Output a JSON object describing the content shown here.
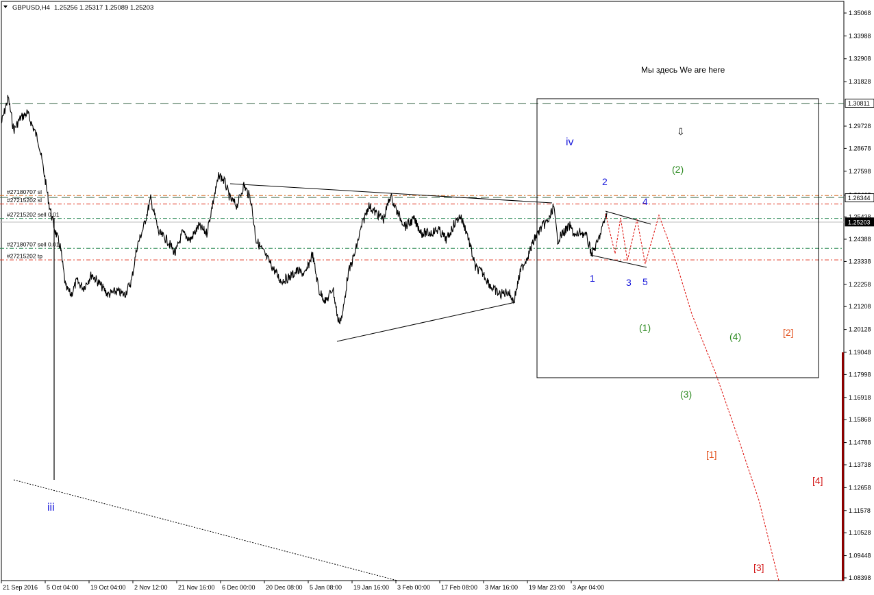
{
  "header": {
    "symbol_label": "GBPUSD,H4",
    "quote_values": "1.25256 1.25317 1.25089 1.25203",
    "dropdown_icon": "triangle-down-icon"
  },
  "price_axis": {
    "ticks": [
      "1.35068",
      "1.33988",
      "1.32908",
      "1.31828",
      "1.29728",
      "1.28678",
      "1.27598",
      "1.26468",
      "1.25438",
      "1.24388",
      "1.23338",
      "1.22258",
      "1.21208",
      "1.20128",
      "1.19048",
      "1.17998",
      "1.16918",
      "1.15868",
      "1.14788",
      "1.13738",
      "1.12658",
      "1.11578",
      "1.10528",
      "1.09448",
      "1.08398"
    ],
    "tick_values": [
      1.35068,
      1.33988,
      1.32908,
      1.31828,
      1.29728,
      1.28678,
      1.27598,
      1.26468,
      1.25438,
      1.24388,
      1.23338,
      1.22258,
      1.21208,
      1.20128,
      1.19048,
      1.17998,
      1.16918,
      1.15868,
      1.14788,
      1.13738,
      1.12658,
      1.11578,
      1.10528,
      1.09448,
      1.08398
    ],
    "labels": [
      {
        "text": "1.30811",
        "value": 1.30811,
        "bg": "#ffffff",
        "fg": "#000000"
      },
      {
        "text": "1.26344",
        "value": 1.26344,
        "bg": "#ffffff",
        "fg": "#000000"
      },
      {
        "text": "1.25203",
        "value": 1.25203,
        "bg": "#000000",
        "fg": "#ffffff"
      }
    ]
  },
  "time_axis": {
    "ticks": [
      "21 Sep 2016",
      "5 Oct 04:00",
      "19 Oct 04:00",
      "2 Nov 12:00",
      "21 Nov 16:00",
      "6 Dec 00:00",
      "20 Dec 08:00",
      "5 Jan 08:00",
      "19 Jan 16:00",
      "3 Feb 00:00",
      "17 Feb 08:00",
      "3 Mar 16:00",
      "19 Mar 23:00",
      "3 Apr 04:00"
    ]
  },
  "trade_lines": [
    {
      "label": "#27180707 sl",
      "value": 1.2645,
      "color": "#d2691e",
      "style": "dashdot"
    },
    {
      "label": "#27215202 sl",
      "value": 1.2605,
      "color": "#e0301e",
      "style": "dashdot"
    },
    {
      "label": "#27215202 sell 0.01",
      "value": 1.2537,
      "color": "#2e8b57",
      "style": "dashdot"
    },
    {
      "label": "#27180707 sell 0.01",
      "value": 1.2396,
      "color": "#2e8b57",
      "style": "dashdot"
    },
    {
      "label": "#27215202 tp",
      "value": 1.2341,
      "color": "#e0301e",
      "style": "dashdot"
    }
  ],
  "annotation": {
    "text": "Мы здесь We are here"
  },
  "wave_labels": [
    {
      "text": "iv",
      "color": "#1a1adb"
    },
    {
      "text": "2",
      "color": "#1a1adb"
    },
    {
      "text": "4",
      "color": "#1a1adb"
    },
    {
      "text": "1",
      "color": "#1a1adb"
    },
    {
      "text": "3",
      "color": "#1a1adb"
    },
    {
      "text": "5",
      "color": "#1a1adb"
    },
    {
      "text": "(2)",
      "color": "#2e8b22"
    },
    {
      "text": "(1)",
      "color": "#2e8b22"
    },
    {
      "text": "(4)",
      "color": "#2e8b22"
    },
    {
      "text": "(3)",
      "color": "#2e8b22"
    },
    {
      "text": "[2]",
      "color": "#e2501c"
    },
    {
      "text": "[1]",
      "color": "#e2501c"
    },
    {
      "text": "[4]",
      "color": "#d41c1c"
    },
    {
      "text": "[3]",
      "color": "#d41c1c"
    },
    {
      "text": "iii",
      "color": "#1a1adb"
    }
  ],
  "arrow_icon": {
    "name": "arrow-down-icon",
    "glyph": "⇩"
  }
}
